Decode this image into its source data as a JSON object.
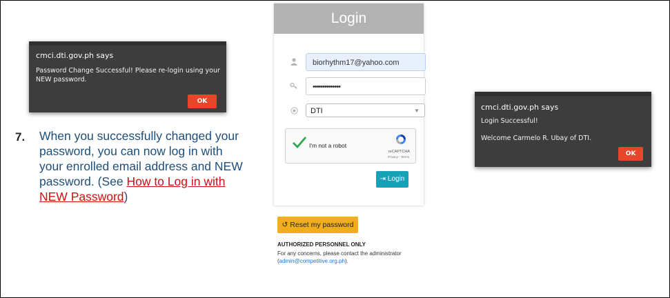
{
  "dialog_password_change": {
    "site": "cmci.dti.gov.ph says",
    "message": "Password Change Successful! Please re-login using your NEW password.",
    "ok_label": "OK"
  },
  "instruction": {
    "number": "7.",
    "text": "When you successfully changed your password, you can now log in with your enrolled email address and NEW password. (See ",
    "link_text": "How to Log in with NEW Password",
    "tail": ")"
  },
  "login": {
    "title": "Login",
    "email_value": "biorhythm17@yahoo.com",
    "password_value": "••••••••••••••",
    "agency_value": "DTI",
    "captcha_label": "I'm not a robot",
    "captcha_brand": "reCAPTCHA",
    "captcha_terms": "Privacy - Terms",
    "login_button": "Login",
    "reset_button": "Reset my password",
    "authorized_title": "AUTHORIZED PERSONNEL ONLY",
    "authorized_text": "For any concerns, please contact the administrator (",
    "admin_email": "admin@competitive.org.ph",
    "authorized_tail": ")."
  },
  "dialog_login_success": {
    "site": "cmci.dti.gov.ph says",
    "message1": "Login Successful!",
    "message2": "Welcome Carmelo R. Ubay of DTI.",
    "ok_label": "OK"
  },
  "colors": {
    "dialog_bg": "#3d3d3d",
    "ok_button": "#e8462b",
    "instruction_text": "#1f4e79",
    "link": "#d01010",
    "login_button": "#17a2b8",
    "reset_button": "#f0ad1e",
    "login_header": "#b3b3b3"
  }
}
